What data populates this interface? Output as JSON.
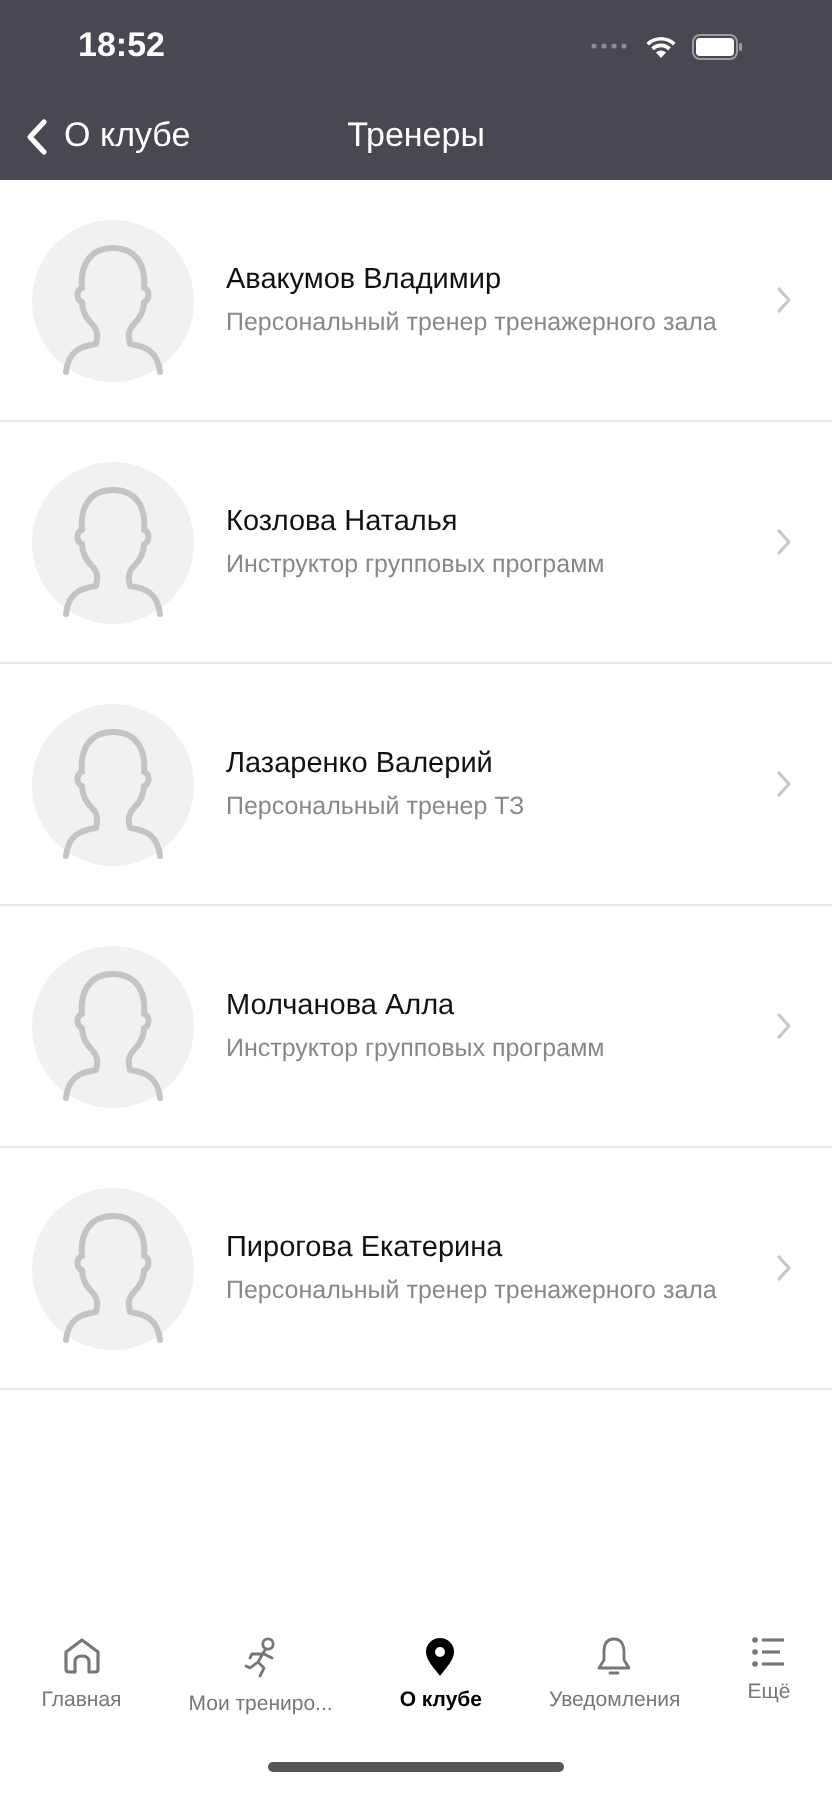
{
  "status_bar": {
    "time": "18:52"
  },
  "nav": {
    "back": "О клубе",
    "title": "Тренеры"
  },
  "trainers": [
    {
      "name": "Авакумов Владимир",
      "role": "Персональный тренер тренажерного зала"
    },
    {
      "name": "Козлова Наталья",
      "role": "Инструктор групповых программ"
    },
    {
      "name": "Лазаренко Валерий",
      "role": "Персональный тренер ТЗ"
    },
    {
      "name": "Молчанова Алла",
      "role": "Инструктор групповых программ"
    },
    {
      "name": "Пирогова Екатерина",
      "role": "Персональный тренер тренажерного зала"
    }
  ],
  "tab_bar": [
    {
      "kind": "home",
      "label": "Главная",
      "selected": false
    },
    {
      "kind": "workouts",
      "label": "Мои трениро...",
      "selected": false
    },
    {
      "kind": "club",
      "label": "О клубе",
      "selected": true
    },
    {
      "kind": "notifications",
      "label": "Уведомления",
      "selected": false
    },
    {
      "kind": "more",
      "label": "Ещё",
      "selected": false
    }
  ]
}
